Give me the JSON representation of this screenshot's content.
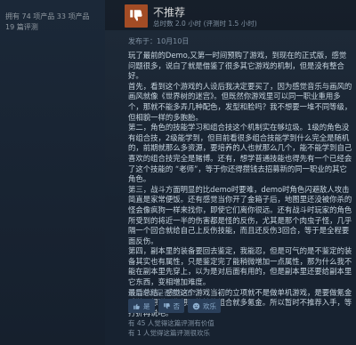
{
  "user": {
    "stats_line1": "拥有 74 项产品 33 项产品",
    "stats_line2": "19 篇评测"
  },
  "review": {
    "verdict": "不推荐",
    "hours": "总时数 2.0 小时 (评测时 1.5 小时)",
    "posted": "发布于：10月10日",
    "paragraphs": [
      "玩了最前的Demo,又第一时间预购了游戏，到现在的正式版，感觉问题很多，说白了就是借鉴了很多其它游戏的机制，但是没有整合好。",
      "首先，看到这个游戏的人设后我决定要买了，因为感觉音乐与画风的画风就像《世界树的迷宫》。但既然你游戏里可以同一职业重用多个，那就不能多弄几种配色，发型和脸吗？我不想要一堆不同等级，但相貌一样的多胞胎。",
      "第二，角色的技能学习和组合技这个机制实在够垃圾。1级的角色没有组合技，2级能学到，但目前看很多组合技能学到什么完全是随机的，前期就那么多资源，要培养的人也就那么几个，能不能学到自己喜欢的组合技完全是赌博。还有，想学普通技能也得先有一个已经会了这个技能的 “老师”，等于你还得攒钱去招募新的同一职业的其它角色。",
      "第三，战斗方面明显的比demo时要难，demo时角色闪避敌人攻击简直是家常便饭。还有感觉当你开了金箱子后，地图里还没被你杀的怪会像疯狗一样来找你，即使它们离你很远。还有战斗时玩家的角色所受到的将近一半的伤害都是怪的反伤，尤其是那个肉虫子怪，几乎隔一个回合就给自己上反伤技能，而且还反伤3回合，等于是全程要面反伤。",
      "第四，副本里的装备要回去鉴定，我能忍，但是可气的是不鉴定的装备其实也有属性，只是鉴定完了能稍微增加一点属性，那为什么我不能在副本里先穿上，以为是对后面有用的，但是副本里还要给副本里它东西，变相增加难度。",
      "最后总结，感觉这个游戏当初的立项就不是做单机游戏，是要做氪金手游，想赚到你想要的技能组合就多氪金。所以暂时不推荐入手，等打折再说吧。"
    ],
    "helpful_question": "这篇评测是否有价值？",
    "buttons": {
      "yes": "是",
      "no": "否",
      "funny": "欢乐"
    },
    "helpful_count": "有 45 人觉得这篇评测有价值",
    "funny_count": "有 1 人觉得这篇评测很欢乐"
  },
  "colors": {
    "thumb_down_bg": "#a34c25",
    "button_bg": "#2a3f5a"
  }
}
